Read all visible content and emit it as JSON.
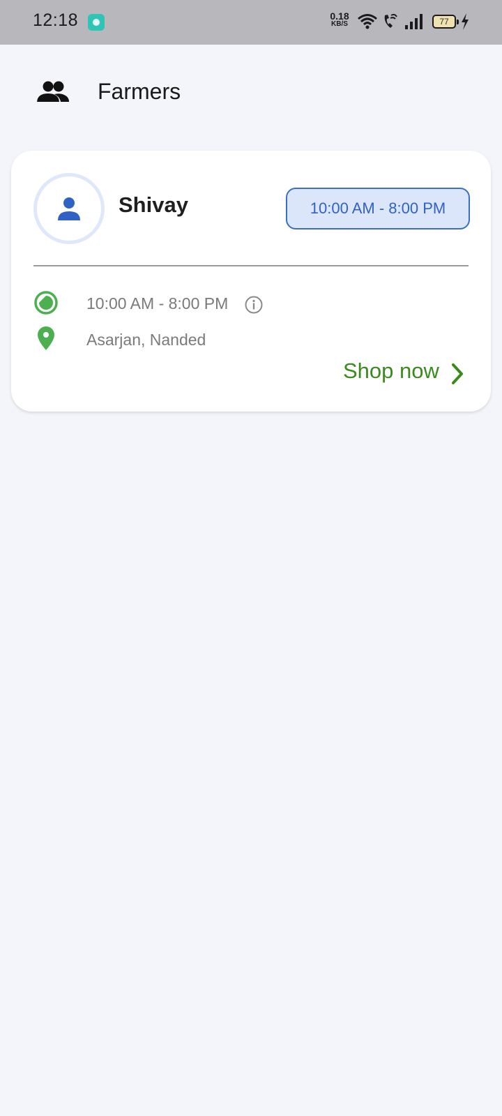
{
  "status_bar": {
    "time": "12:18",
    "net_speed_value": "0.18",
    "net_speed_unit": "KB/S",
    "battery_level": "77"
  },
  "header": {
    "icon": "people-icon",
    "title": "Farmers"
  },
  "farmers": [
    {
      "name": "Shivay",
      "hours_badge": "10:00 AM - 8:00 PM",
      "hours": "10:00 AM - 8:00 PM",
      "location": "Asarjan, Nanded",
      "action_label": "Shop now"
    }
  ],
  "colors": {
    "background": "#f3f5fa",
    "accent_blue": "#2f62c4",
    "badge_fill": "#dbe6fb",
    "accent_green": "#3a8a1e",
    "icon_green": "#4caf50"
  }
}
